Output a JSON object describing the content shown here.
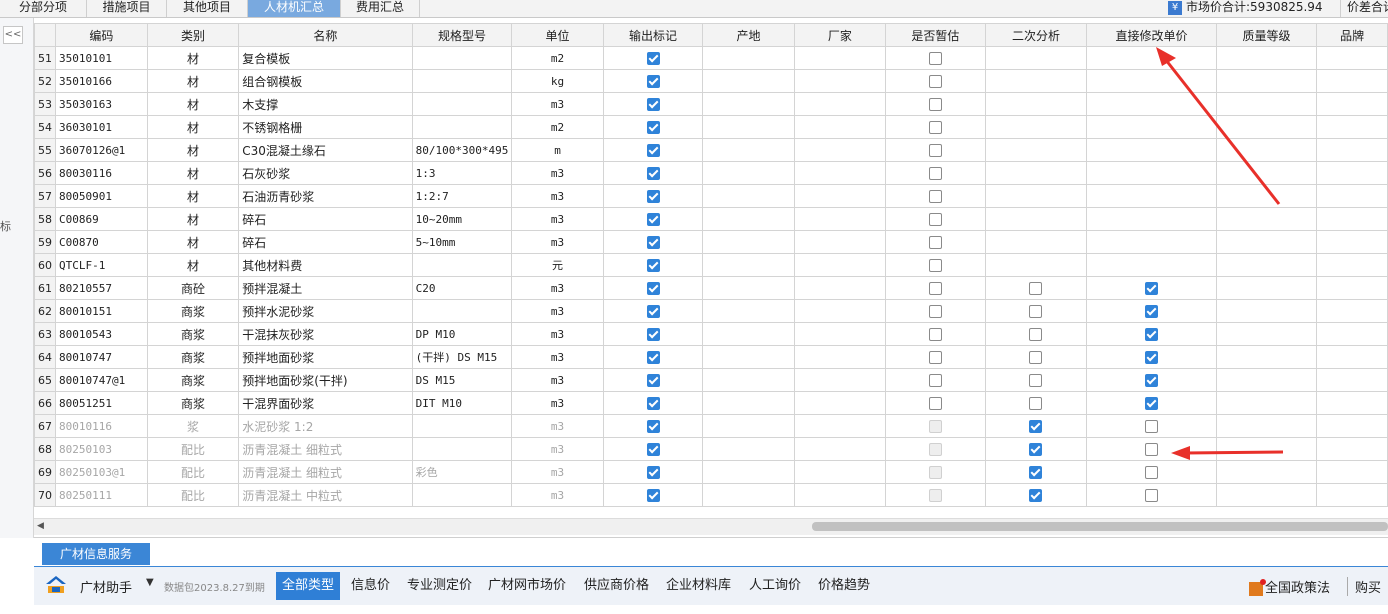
{
  "tabs": [
    {
      "label": "分部分项",
      "active": false
    },
    {
      "label": "措施项目",
      "active": false
    },
    {
      "label": "其他项目",
      "active": false
    },
    {
      "label": "人材机汇总",
      "active": true
    },
    {
      "label": "费用汇总",
      "active": false
    }
  ],
  "market_total": {
    "icon": "yen-icon",
    "text": "市场价合计:5930825.94"
  },
  "price_col_label": "价差合计",
  "collapse_label": "<<",
  "left_glyph": "标",
  "columns": [
    "",
    "编码",
    "类别",
    "名称",
    "规格型号",
    "单位",
    "输出标记",
    "产地",
    "厂家",
    "是否暂估",
    "二次分析",
    "直接修改单价",
    "质量等级",
    "品牌"
  ],
  "rows": [
    {
      "num": "51",
      "code": "35010101",
      "type": "材",
      "name": "复合模板",
      "spec": "",
      "unit": "m2",
      "output": true,
      "est": "off",
      "second": null,
      "direct": null,
      "grey": false
    },
    {
      "num": "52",
      "code": "35010166",
      "type": "材",
      "name": "组合钢模板",
      "spec": "",
      "unit": "kg",
      "output": true,
      "est": "off",
      "second": null,
      "direct": null,
      "grey": false
    },
    {
      "num": "53",
      "code": "35030163",
      "type": "材",
      "name": "木支撑",
      "spec": "",
      "unit": "m3",
      "output": true,
      "est": "off",
      "second": null,
      "direct": null,
      "grey": false
    },
    {
      "num": "54",
      "code": "36030101",
      "type": "材",
      "name": "不锈钢格栅",
      "spec": "",
      "unit": "m2",
      "output": true,
      "est": "off",
      "second": null,
      "direct": null,
      "grey": false
    },
    {
      "num": "55",
      "code": "36070126@1",
      "type": "材",
      "name": "C30混凝土缘石",
      "spec": "80/100*300*495",
      "unit": "m",
      "output": true,
      "est": "off",
      "second": null,
      "direct": null,
      "grey": false
    },
    {
      "num": "56",
      "code": "80030116",
      "type": "材",
      "name": "石灰砂浆",
      "spec": "1:3",
      "unit": "m3",
      "output": true,
      "est": "off",
      "second": null,
      "direct": null,
      "grey": false
    },
    {
      "num": "57",
      "code": "80050901",
      "type": "材",
      "name": "石油沥青砂浆",
      "spec": "1:2:7",
      "unit": "m3",
      "output": true,
      "est": "off",
      "second": null,
      "direct": null,
      "grey": false
    },
    {
      "num": "58",
      "code": "C00869",
      "type": "材",
      "name": "碎石",
      "spec": "10~20mm",
      "unit": "m3",
      "output": true,
      "est": "off",
      "second": null,
      "direct": null,
      "grey": false
    },
    {
      "num": "59",
      "code": "C00870",
      "type": "材",
      "name": "碎石",
      "spec": "5~10mm",
      "unit": "m3",
      "output": true,
      "est": "off",
      "second": null,
      "direct": null,
      "grey": false
    },
    {
      "num": "60",
      "code": "QTCLF-1",
      "type": "材",
      "name": "其他材料费",
      "spec": "",
      "unit": "元",
      "output": true,
      "est": "off",
      "second": null,
      "direct": null,
      "grey": false
    },
    {
      "num": "61",
      "code": "80210557",
      "type": "商砼",
      "name": "预拌混凝土",
      "spec": "C20",
      "unit": "m3",
      "output": true,
      "est": "off",
      "second": false,
      "direct": true,
      "grey": false
    },
    {
      "num": "62",
      "code": "80010151",
      "type": "商浆",
      "name": "预拌水泥砂浆",
      "spec": "",
      "unit": "m3",
      "output": true,
      "est": "off",
      "second": false,
      "direct": true,
      "grey": false
    },
    {
      "num": "63",
      "code": "80010543",
      "type": "商浆",
      "name": "干混抹灰砂浆",
      "spec": "DP M10",
      "unit": "m3",
      "output": true,
      "est": "off",
      "second": false,
      "direct": true,
      "grey": false
    },
    {
      "num": "64",
      "code": "80010747",
      "type": "商浆",
      "name": "预拌地面砂浆",
      "spec": "(干拌) DS M15",
      "unit": "m3",
      "output": true,
      "est": "off",
      "second": false,
      "direct": true,
      "grey": false
    },
    {
      "num": "65",
      "code": "80010747@1",
      "type": "商浆",
      "name": "预拌地面砂浆(干拌)",
      "spec": "DS M15",
      "unit": "m3",
      "output": true,
      "est": "off",
      "second": false,
      "direct": true,
      "grey": false
    },
    {
      "num": "66",
      "code": "80051251",
      "type": "商浆",
      "name": "干混界面砂浆",
      "spec": "DIT M10",
      "unit": "m3",
      "output": true,
      "est": "off",
      "second": false,
      "direct": true,
      "grey": false
    },
    {
      "num": "67",
      "code": "80010116",
      "type": "浆",
      "name": "水泥砂浆 1:2",
      "spec": "",
      "unit": "m3",
      "output": true,
      "est": "disabled",
      "second": true,
      "direct": false,
      "grey": true
    },
    {
      "num": "68",
      "code": "80250103",
      "type": "配比",
      "name": "沥青混凝土 细粒式",
      "spec": "",
      "unit": "m3",
      "output": true,
      "est": "disabled",
      "second": true,
      "direct": false,
      "grey": true
    },
    {
      "num": "69",
      "code": "80250103@1",
      "type": "配比",
      "name": "沥青混凝土 细粒式",
      "spec": "彩色",
      "unit": "m3",
      "output": true,
      "est": "disabled",
      "second": true,
      "direct": false,
      "grey": true
    },
    {
      "num": "70",
      "code": "80250111",
      "type": "配比",
      "name": "沥青混凝土 中粒式",
      "spec": "",
      "unit": "m3",
      "output": true,
      "est": "disabled",
      "second": true,
      "direct": false,
      "grey": true
    }
  ],
  "bottom": {
    "service_tab": "广材信息服务",
    "assistant": "广材助手",
    "expiry": "数据包2023.8.27到期",
    "nav": [
      "全部类型",
      "信息价",
      "专业测定价",
      "广材网市场价",
      "供应商价格",
      "企业材料库",
      "人工询价",
      "价格趋势"
    ],
    "policy": "全国政策法",
    "buy": "购买"
  },
  "colors": {
    "accent": "#2f83d9",
    "annotation_arrow": "#e8302a"
  }
}
